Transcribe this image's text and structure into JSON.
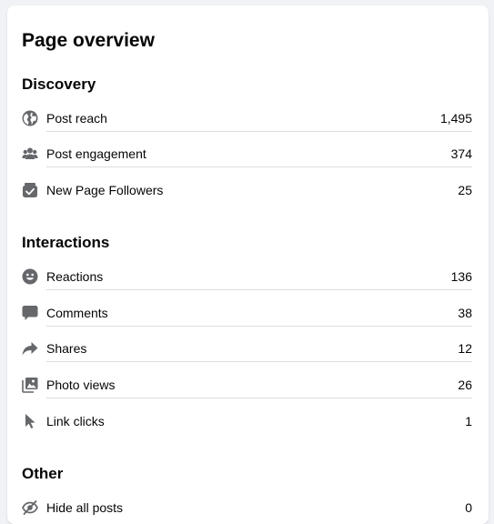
{
  "page": {
    "title": "Page overview"
  },
  "sections": {
    "discovery": {
      "title": "Discovery",
      "items": [
        {
          "label": "Post reach",
          "value": "1,495",
          "icon": "globe-icon"
        },
        {
          "label": "Post engagement",
          "value": "374",
          "icon": "people-icon"
        },
        {
          "label": "New Page Followers",
          "value": "25",
          "icon": "follow-check-icon"
        }
      ]
    },
    "interactions": {
      "title": "Interactions",
      "items": [
        {
          "label": "Reactions",
          "value": "136",
          "icon": "smiley-icon"
        },
        {
          "label": "Comments",
          "value": "38",
          "icon": "comment-icon"
        },
        {
          "label": "Shares",
          "value": "12",
          "icon": "share-icon"
        },
        {
          "label": "Photo views",
          "value": "26",
          "icon": "photo-icon"
        },
        {
          "label": "Link clicks",
          "value": "1",
          "icon": "cursor-icon"
        }
      ]
    },
    "other": {
      "title": "Other",
      "items": [
        {
          "label": "Hide all posts",
          "value": "0",
          "icon": "eye-slash-icon"
        }
      ]
    }
  },
  "colors": {
    "icon": "#65676b",
    "divider": "#dadde1",
    "text": "#050505",
    "background": "#f0f2f5",
    "card": "#ffffff"
  }
}
